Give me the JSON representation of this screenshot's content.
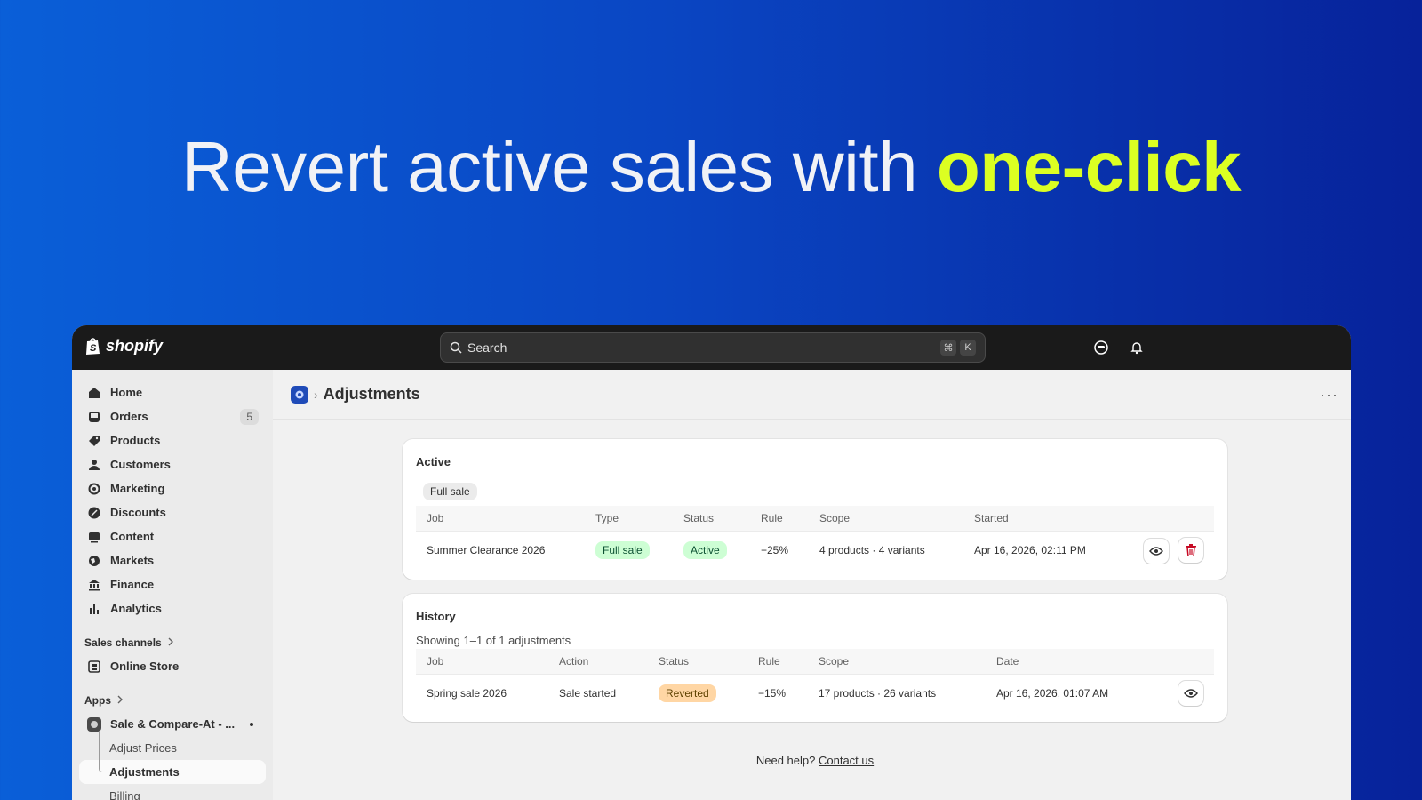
{
  "headline": {
    "text": "Revert active sales with ",
    "highlight": "one-click"
  },
  "brand": {
    "name": "shopify"
  },
  "search": {
    "placeholder": "Search",
    "shortcut_1": "⌘",
    "shortcut_2": "K"
  },
  "sidebar": {
    "items": [
      {
        "label": "Home"
      },
      {
        "label": "Orders",
        "count": "5"
      },
      {
        "label": "Products"
      },
      {
        "label": "Customers"
      },
      {
        "label": "Marketing"
      },
      {
        "label": "Discounts"
      },
      {
        "label": "Content"
      },
      {
        "label": "Markets"
      },
      {
        "label": "Finance"
      },
      {
        "label": "Analytics"
      }
    ],
    "sales_channels_label": "Sales channels",
    "online_store": "Online Store",
    "apps_label": "Apps",
    "app_name": "Sale & Compare-At - ...",
    "sub_items": [
      "Adjust Prices",
      "Adjustments",
      "Billing"
    ]
  },
  "page": {
    "title": "Adjustments"
  },
  "active_card": {
    "title": "Active",
    "filter_chip": "Full sale",
    "columns": [
      "Job",
      "Type",
      "Status",
      "Rule",
      "Scope",
      "Started"
    ],
    "row": {
      "job": "Summer Clearance 2026",
      "type": "Full sale",
      "status": "Active",
      "rule": "−25%",
      "scope": "4 products · 4 variants",
      "started": "Apr 16, 2026, 02:11 PM"
    }
  },
  "history_card": {
    "title": "History",
    "showing": "Showing 1–1 of 1 adjustments",
    "columns": [
      "Job",
      "Action",
      "Status",
      "Rule",
      "Scope",
      "Date"
    ],
    "row": {
      "job": "Spring sale 2026",
      "action": "Sale started",
      "status": "Reverted",
      "rule": "−15%",
      "scope": "17 products · 26 variants",
      "date": "Apr 16, 2026, 01:07 AM"
    }
  },
  "help": {
    "text": "Need help?",
    "link": "Contact us"
  },
  "colors": {
    "background_start": "#0a5fd8",
    "background_end": "#07229a",
    "highlight": "#dcff22",
    "topbar": "#1a1a1a"
  }
}
